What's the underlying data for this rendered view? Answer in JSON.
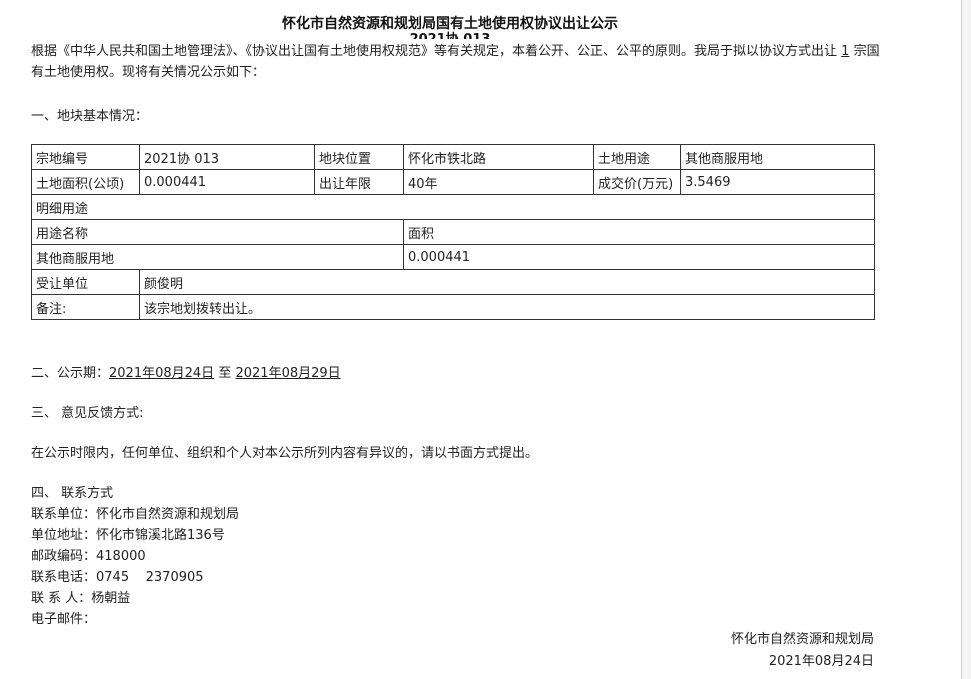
{
  "title": "怀化市自然资源和规划局国有土地使用权协议出让公示",
  "subtitle": "2021协    013",
  "intro": {
    "part1": "根据《中华人民共和国土地管理法》、《协议出让国有土地使用权规范》等有关规定，本着公开、公正、公平的原则。我局于拟以协议方式出让",
    "count": "1",
    "part2": "宗国有土地使用权。现将有关情况公示如下："
  },
  "section1_title": "一、地块基本情况：",
  "table": {
    "row1": {
      "k1": "宗地编号",
      "v1": "2021协    013",
      "k2": "地块位置",
      "v2": "怀化市铁北路",
      "k3": "土地用途",
      "v3": "其他商服用地"
    },
    "row2": {
      "k1": "土地面积(公顷)",
      "v1": "0.000441",
      "k2": "出让年限",
      "v2": "40年",
      "k3": "成交价(万元)",
      "v3": "3.5469"
    },
    "detail_header": "明细用途",
    "use_name_header": "用途名称",
    "area_header": "面积",
    "use_name": "其他商服用地",
    "use_area": "0.000441",
    "transferee_label": "受让单位",
    "transferee": "颜俊明",
    "remark_label": "备注:",
    "remark": "该宗地划拨转出让。"
  },
  "section2": {
    "label": "二、公示期：",
    "start": "2021年08月24日",
    "to": "至",
    "end": "2021年08月29日"
  },
  "section3_title": "三、 意见反馈方式:",
  "section3_text": "在公示时限内，任何单位、组织和个人对本公示所列内容有异议的，请以书面方式提出。",
  "section4_title": "四、 联系方式",
  "contact": {
    "unit_label": "联系单位：",
    "unit": "怀化市自然资源和规划局",
    "address_label": "单位地址：",
    "address": "怀化市锦溪北路136号",
    "postcode_label": "邮政编码：",
    "postcode": "418000",
    "phone_label": "联系电话：",
    "phone": "0745    2370905",
    "person_label": "联 系 人：",
    "person": "杨朝益",
    "email_label": "电子邮件：",
    "email": ""
  },
  "signature": {
    "org": "怀化市自然资源和规划局",
    "date": "2021年08月24日"
  }
}
